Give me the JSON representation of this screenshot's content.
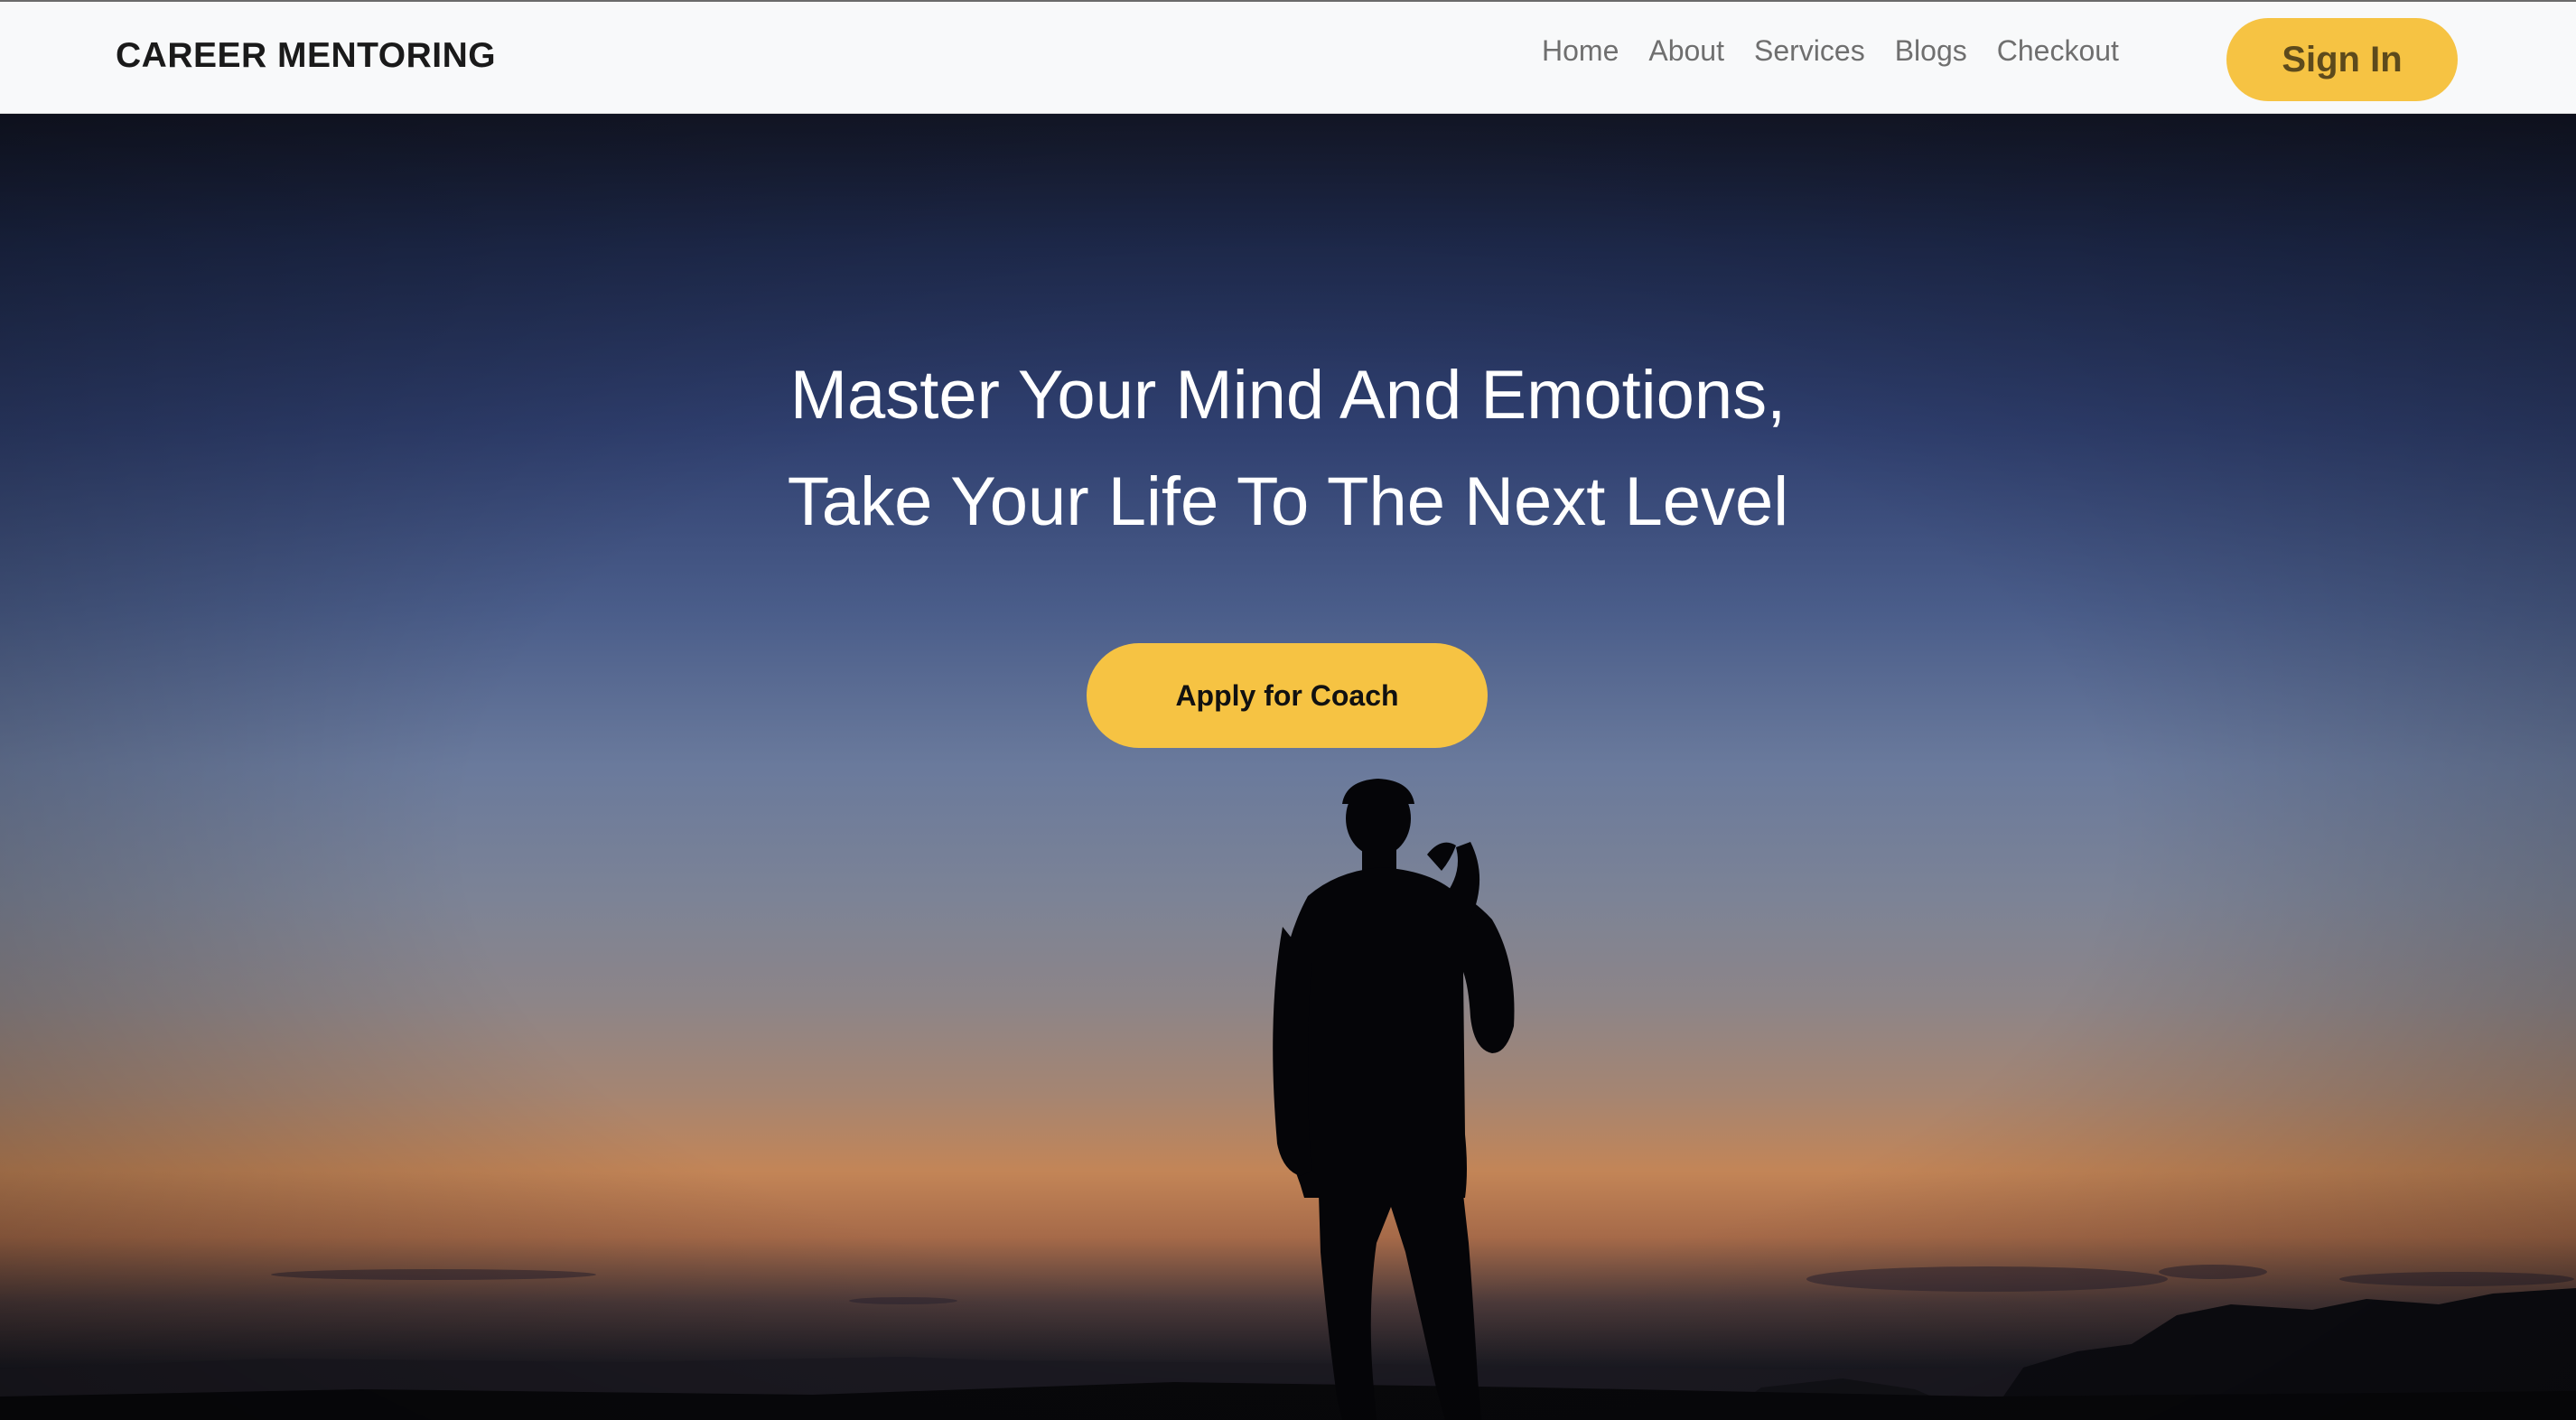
{
  "brand": {
    "name": "CAREER MENTORING"
  },
  "nav": {
    "links": [
      "Home",
      "About",
      "Services",
      "Blogs",
      "Checkout"
    ],
    "signin_label": "Sign In"
  },
  "hero": {
    "headline_line1": "Master Your Mind And Emotions,",
    "headline_line2": "Take Your Life To The Next Level",
    "cta_label": "Apply for Coach",
    "background_image": "silhouette-person-at-dusk"
  },
  "colors": {
    "accent": "#f6c343",
    "navbar_bg": "#f8f9fa",
    "nav_text": "#6f6f6f",
    "brand_text": "#1a1a1a"
  }
}
